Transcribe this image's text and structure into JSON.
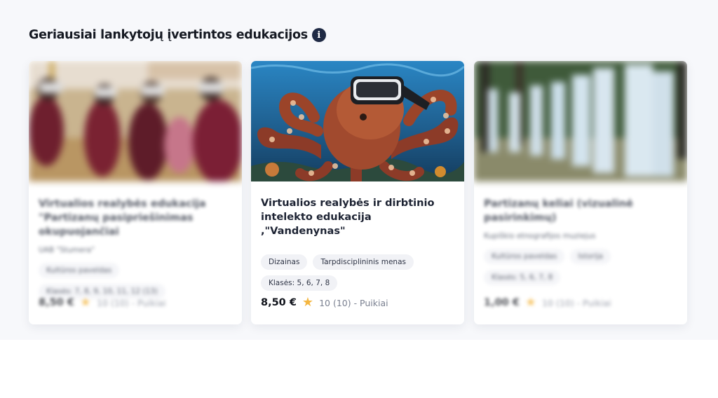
{
  "section": {
    "title": "Geriausiai lankytojų įvertintos edukacijos",
    "info_icon": "info-icon"
  },
  "cards": [
    {
      "title": "Virtualios realybės edukacija \"Partizanų pasipriešinimas okupuojančiai",
      "provider": "UAB \"Stumera\"",
      "tags": [
        "Kultūros paveldas",
        "Klasės: 7, 8, 9, 10, 11, 12 (13)"
      ],
      "price": "8,50 €",
      "rating": "10 (10) - Puikiai",
      "blurred": true
    },
    {
      "title": "Virtualios realybės ir dirbtinio intelekto edukacija ,\"Vandenynas\"",
      "provider": "",
      "tags": [
        "Dizainas",
        "Tarpdisciplininis menas",
        "Klasės: 5, 6, 7, 8"
      ],
      "price": "8,50 €",
      "rating": "10 (10) - Puikiai",
      "blurred": false
    },
    {
      "title": "Partizanų keliai (vizualinė pasirinkimų)",
      "provider": "Kupiškio etnografijos muziejus",
      "tags": [
        "Kultūros paveldas",
        "Istorija",
        "Klasės: 5, 6, 7, 8"
      ],
      "price": "1,00 €",
      "rating": "10 (10) - Puikiai",
      "blurred": true
    }
  ],
  "colors": {
    "accent": "#1f2a44",
    "star": "#f4b640",
    "tag_bg": "#f1f2f6",
    "band_bg": "#f7f8fb"
  }
}
